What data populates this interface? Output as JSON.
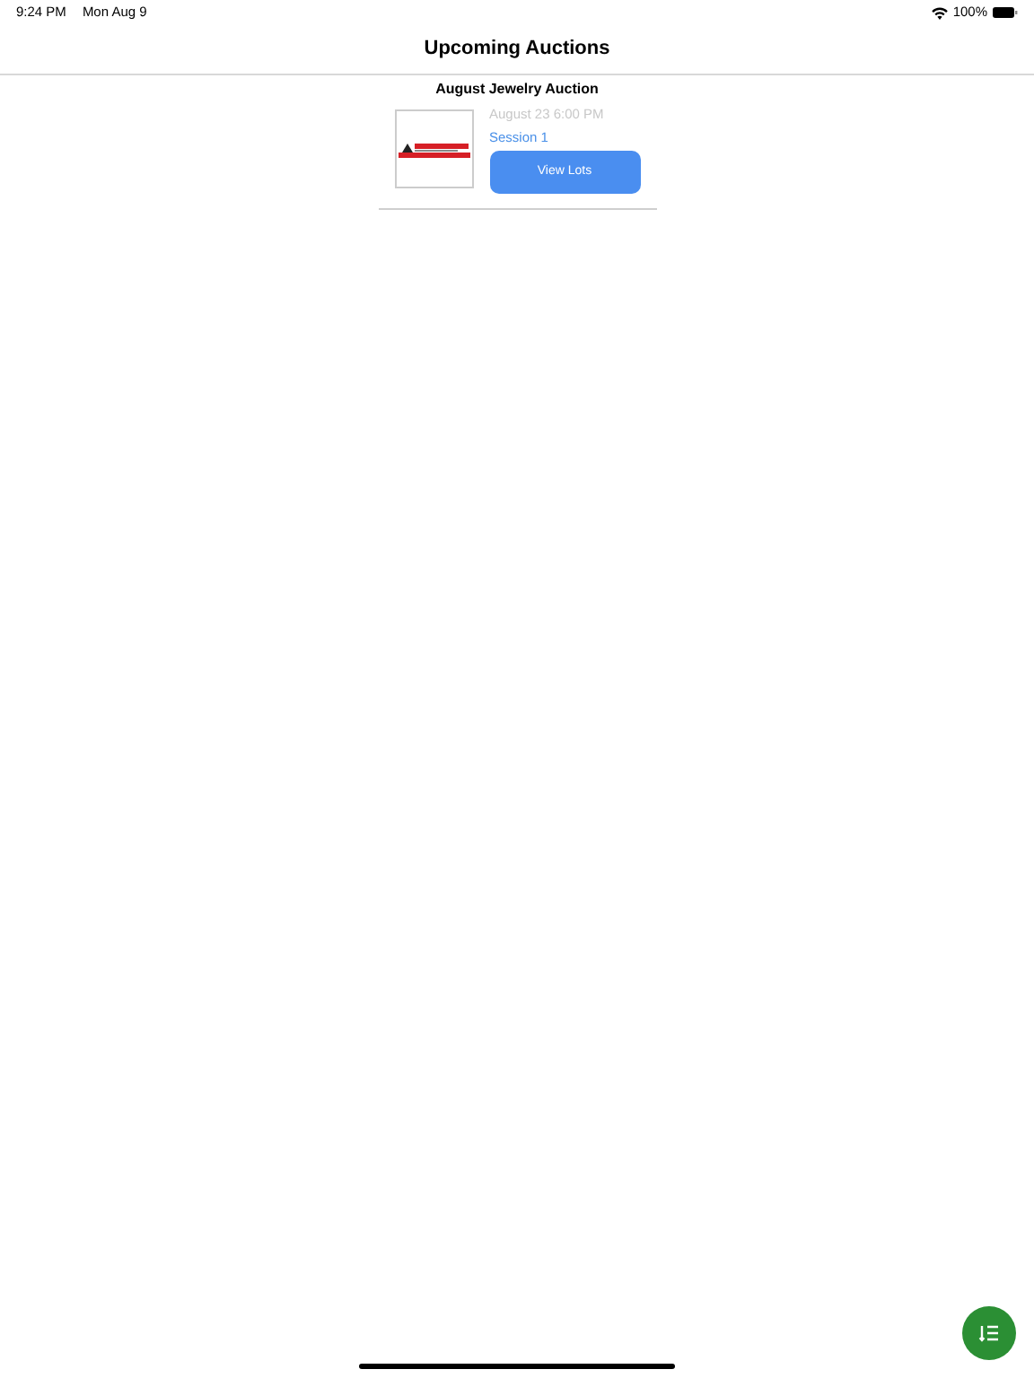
{
  "status_bar": {
    "time": "9:24 PM",
    "date": "Mon Aug 9",
    "battery": "100%"
  },
  "title": "Upcoming Auctions",
  "auctions": [
    {
      "name": "August Jewelry Auction",
      "date": "August 23 6:00 PM",
      "session": "Session 1",
      "button": "View Lots"
    }
  ]
}
